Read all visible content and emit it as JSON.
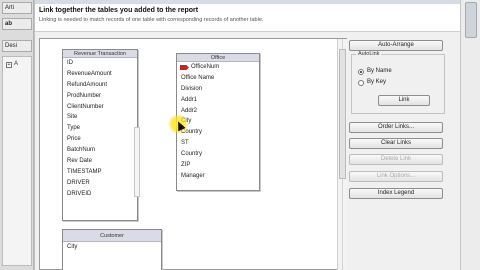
{
  "app_strip": {
    "cells": [
      "Arti",
      "ab",
      "Desi"
    ],
    "tree_label": "A"
  },
  "dialog": {
    "heading": "Link together the tables you added to the report",
    "subheading": "Linking is needed to match records of one table with corresponding records of another table."
  },
  "tables": [
    {
      "name": "Revenue Transaction",
      "fields": [
        "ID",
        "RevenueAmount",
        "RefundAmount",
        "ProdNumber",
        "ClientNumber",
        "Site",
        "Type",
        "Price",
        "BatchNum",
        "Rev Date",
        "TIMESTAMP",
        "DRIVER",
        "DRIVEID"
      ]
    },
    {
      "name": "Office",
      "fields": [
        "OfficeNum",
        "Office Name",
        "Division",
        "Addr1",
        "Addr2",
        "City",
        "Country",
        "ST",
        "Country",
        "ZIP",
        "Manager"
      ]
    },
    {
      "name": "Customer",
      "fields": [
        "City"
      ]
    }
  ],
  "right_panel": {
    "auto_arrange": "Auto-Arrange",
    "autolink_label": "AutoLink",
    "by_name": "By Name",
    "by_key": "By Key",
    "link": "Link",
    "order_links": "Order Links...",
    "clear_links": "Clear Links",
    "delete_link": "Delete Link",
    "link_options": "Link Options...",
    "index_legend": "Index Legend"
  }
}
